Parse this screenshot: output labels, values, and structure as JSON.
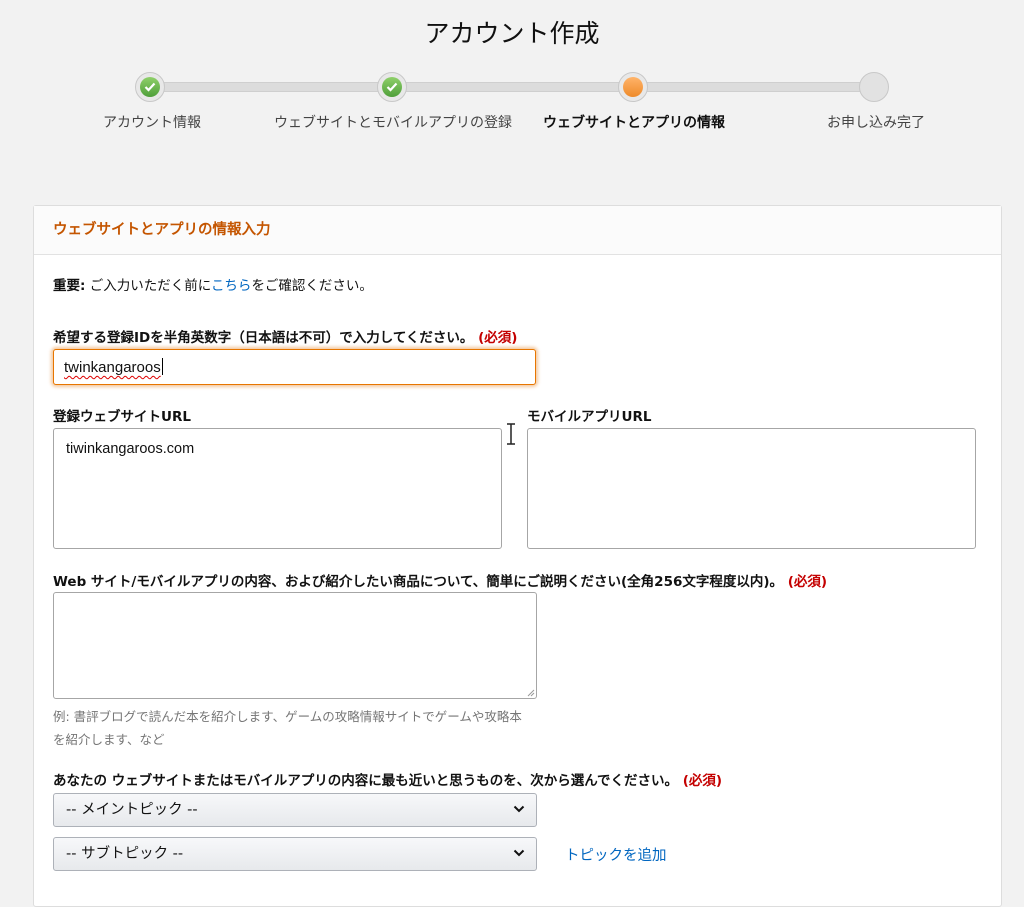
{
  "page": {
    "title": "アカウント作成"
  },
  "stepper": {
    "steps": [
      {
        "label": "アカウント情報",
        "state": "done"
      },
      {
        "label": "ウェブサイトとモバイルアプリの登録",
        "state": "done"
      },
      {
        "label": "ウェブサイトとアプリの情報",
        "state": "current"
      },
      {
        "label": "お申し込み完了",
        "state": "pending"
      }
    ],
    "colors": {
      "done": "#6ab04c",
      "current": "#f0932b",
      "pending": "#e2e2e2"
    }
  },
  "form": {
    "header": "ウェブサイトとアプリの情報入力",
    "notice": {
      "bold": "重要:",
      "before": " ご入力いただく前に",
      "link": "こちら",
      "after": "をご確認ください。"
    },
    "store_id": {
      "label": "希望する登録IDを半角英数字（日本語は不可）で入力してください。",
      "required": "(必須)",
      "value": "twinkangaroos"
    },
    "website_url": {
      "label": "登録ウェブサイトURL",
      "value": "tiwinkangaroos.com"
    },
    "mobile_url": {
      "label": "モバイルアプリURL",
      "value": ""
    },
    "description": {
      "label": "Web サイト/モバイルアプリの内容、および紹介したい商品について、簡単にご説明ください(全角256文字程度以内)。",
      "required": "(必須)",
      "value": "",
      "hint": "例: 書評ブログで読んだ本を紹介します、ゲームの攻略情報サイトでゲームや攻略本を紹介します、など"
    },
    "topic": {
      "label": "あなたの ウェブサイトまたはモバイルアプリの内容に最も近いと思うものを、次から選んでください。",
      "required": "(必須)",
      "main_select": "-- メイントピック --",
      "sub_select": "-- サブトピック --",
      "add_link": "トピックを追加"
    },
    "colors": {
      "accent": "#c45500",
      "link": "#0066c0",
      "required": "#c40000",
      "focus": "#e77600"
    }
  }
}
